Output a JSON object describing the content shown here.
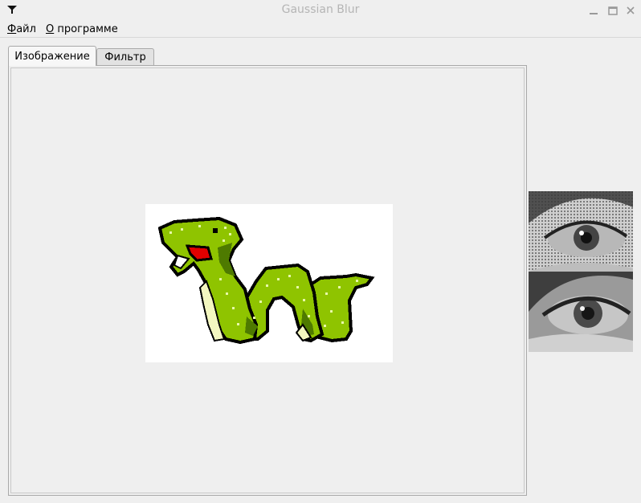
{
  "window": {
    "title": "Gaussian Blur",
    "icon": "funnel-icon",
    "controls": [
      "minimize-icon",
      "maximize-icon",
      "close-icon"
    ]
  },
  "menu": {
    "file": {
      "accel": "Ф",
      "rest": "айл"
    },
    "about": {
      "accel": "О",
      "rest": " программе"
    }
  },
  "tabs": [
    {
      "label": "Изображение",
      "active": true
    },
    {
      "label": "Фильтр",
      "active": false
    }
  ],
  "images": {
    "main": "dragon-pixel-art",
    "thumbnails": [
      "eye-noisy",
      "eye-blurred"
    ]
  },
  "colors": {
    "dragon_green": "#8fc400",
    "dragon_dark": "#4e7a00",
    "mouth_red": "#e00000",
    "belly": "#f3f7c0"
  }
}
